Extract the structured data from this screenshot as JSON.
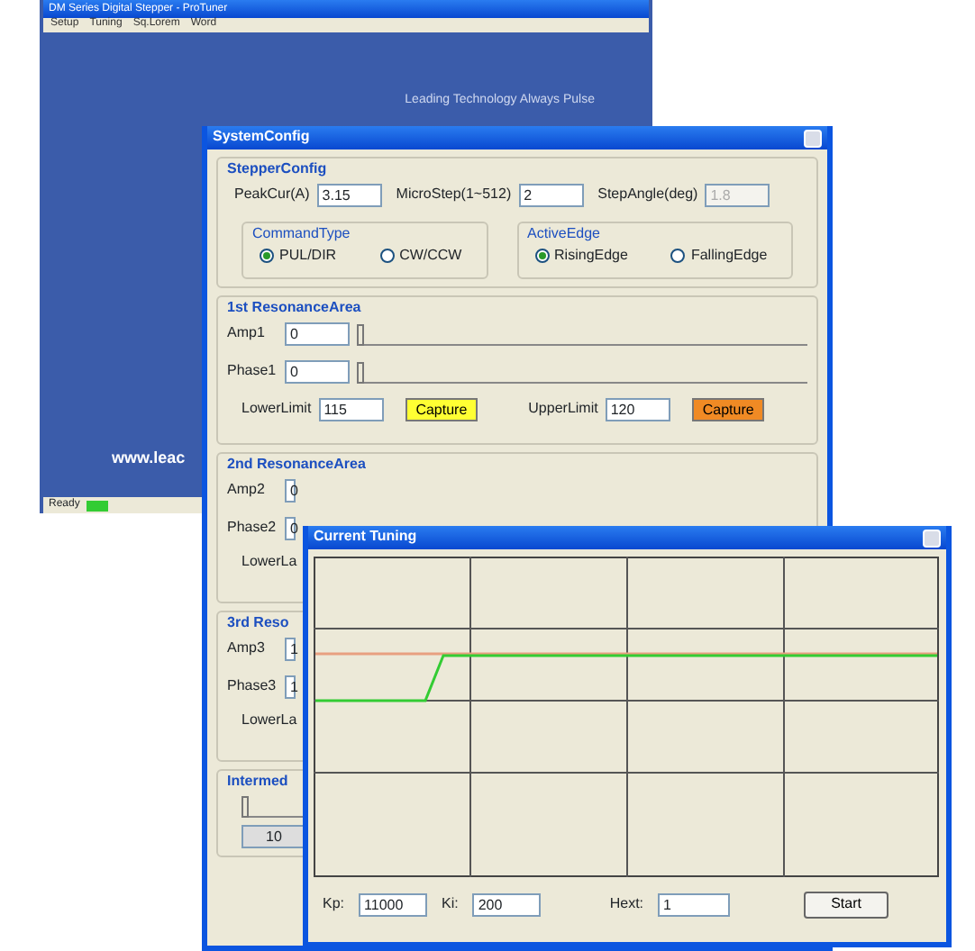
{
  "main_window": {
    "title": "DM Series Digital Stepper - ProTuner",
    "menu": [
      "Setup",
      "Tuning",
      "Sq.Lorem",
      "Word"
    ],
    "slogan": "Leading Technology  Always Pulse",
    "url": "www.leac",
    "status": "Ready"
  },
  "system_config": {
    "title": "SystemConfig",
    "stepper": {
      "title": "StepperConfig",
      "fields": [
        {
          "label": "PeakCur(A)",
          "value": "3.15",
          "disabled": false
        },
        {
          "label": "MicroStep(1~512)",
          "value": "2",
          "disabled": false
        },
        {
          "label": "StepAngle(deg)",
          "value": "1.8",
          "disabled": true
        }
      ],
      "groups": [
        {
          "title": "CommandType",
          "options": [
            {
              "label": "PUL/DIR",
              "selected": true
            },
            {
              "label": "CW/CCW",
              "selected": false
            }
          ]
        },
        {
          "title": "ActiveEdge",
          "options": [
            {
              "label": "RisingEdge",
              "selected": true
            },
            {
              "label": "FallingEdge",
              "selected": false
            }
          ]
        }
      ]
    },
    "resonance": [
      {
        "title": "1st ResonanceArea",
        "rows": [
          {
            "label": "Amp1",
            "value": "0",
            "level": 0
          },
          {
            "label": "Phase1",
            "value": "0",
            "level": 0
          }
        ],
        "lower_label": "LowerLimit",
        "lower": "115",
        "upper_label": "UpperLimit",
        "upper": "120",
        "captures": [
          {
            "label": "Capture",
            "color": "#ffff33"
          },
          {
            "label": "Capture",
            "color": "#f08a24"
          }
        ]
      },
      {
        "title": "2nd ResonanceArea",
        "rows": [
          {
            "label": "Amp2",
            "value": "0"
          },
          {
            "label": "Phase2",
            "value": "0"
          }
        ],
        "lower_label": "LowerLa"
      },
      {
        "title": "3rd Reso",
        "rows": [
          {
            "label": "Amp3",
            "value": "1"
          },
          {
            "label": "Phase3",
            "value": "1"
          }
        ],
        "lower_label": "LowerLa"
      }
    ],
    "intermed": {
      "title": "Intermed",
      "level": 0,
      "value": "10"
    }
  },
  "tuning": {
    "title": "Current Tuning",
    "fields": [
      {
        "label": "Kp:",
        "value": "11000"
      },
      {
        "label": "Ki:",
        "value": "200"
      },
      {
        "label": "Hext:",
        "value": "1"
      }
    ],
    "button": "Start"
  }
}
